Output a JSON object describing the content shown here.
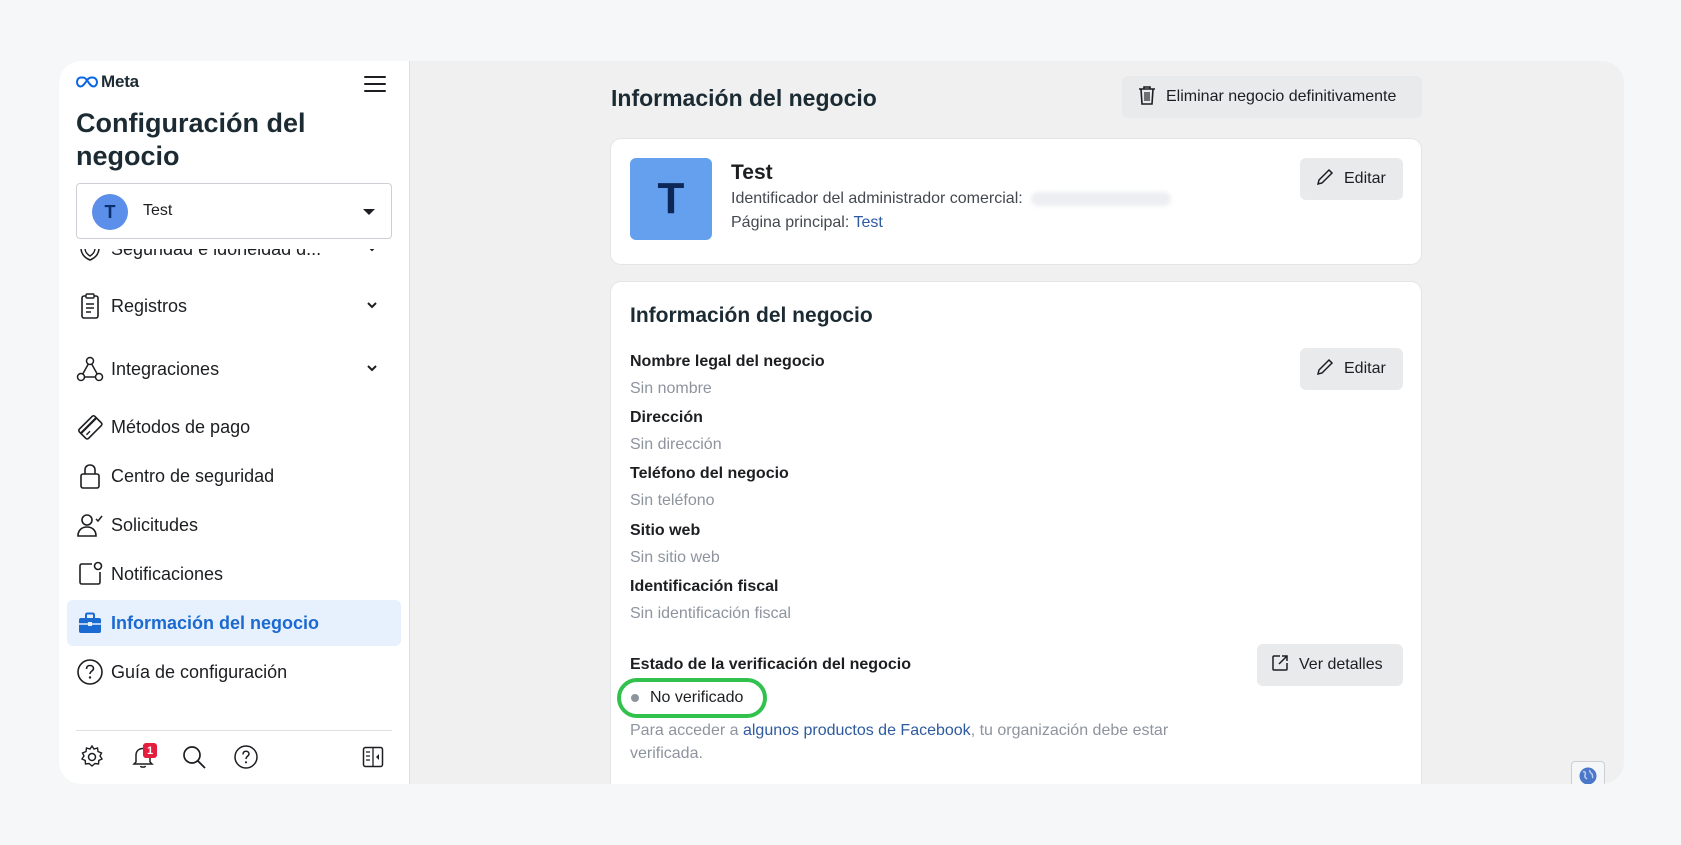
{
  "brand": {
    "name": "Meta"
  },
  "sidebar": {
    "title": "Configuración del negocio",
    "account": {
      "initial": "T",
      "name": "Test"
    },
    "items": [
      {
        "label": "Seguridad e idoneidad d...",
        "icon": "shield-icon",
        "has_chevron": true
      },
      {
        "label": "Registros",
        "icon": "clipboard-icon",
        "has_chevron": true
      },
      {
        "label": "Integraciones",
        "icon": "integrations-icon",
        "has_chevron": true
      },
      {
        "label": "Métodos de pago",
        "icon": "card-icon",
        "has_chevron": false
      },
      {
        "label": "Centro de seguridad",
        "icon": "lock-icon",
        "has_chevron": false
      },
      {
        "label": "Solicitudes",
        "icon": "person-check-icon",
        "has_chevron": false
      },
      {
        "label": "Notificaciones",
        "icon": "notification-square-icon",
        "has_chevron": false
      },
      {
        "label": "Información del negocio",
        "icon": "briefcase-icon",
        "has_chevron": false,
        "active": true
      },
      {
        "label": "Guía de configuración",
        "icon": "help-circle-icon",
        "has_chevron": false
      }
    ],
    "bottom": {
      "notification_count": "1"
    }
  },
  "main": {
    "title": "Información del negocio",
    "delete_label": "Eliminar negocio definitivamente",
    "summary": {
      "logo_initial": "T",
      "name": "Test",
      "admin_id_label": "Identificador del administrador comercial:",
      "main_page_label": "Página principal:",
      "main_page_value": "Test",
      "edit_label": "Editar"
    },
    "details": {
      "title": "Información del negocio",
      "edit_label": "Editar",
      "fields": [
        {
          "label": "Nombre legal del negocio",
          "value": "Sin nombre"
        },
        {
          "label": "Dirección",
          "value": "Sin dirección"
        },
        {
          "label": "Teléfono del negocio",
          "value": "Sin teléfono"
        },
        {
          "label": "Sitio web",
          "value": "Sin sitio web"
        },
        {
          "label": "Identificación fiscal",
          "value": "Sin identificación fiscal"
        }
      ],
      "verification": {
        "label": "Estado de la verificación del negocio",
        "status": "No verificado",
        "details_label": "Ver detalles",
        "note_prefix": "Para acceder a",
        "note_link": "algunos productos de Facebook",
        "note_suffix": ", tu organización debe estar verificada."
      }
    }
  },
  "colors": {
    "accent": "#1b6ad1",
    "active_bg": "#e7f0fd",
    "highlight": "#31c24d",
    "badge": "#e41e3f"
  }
}
